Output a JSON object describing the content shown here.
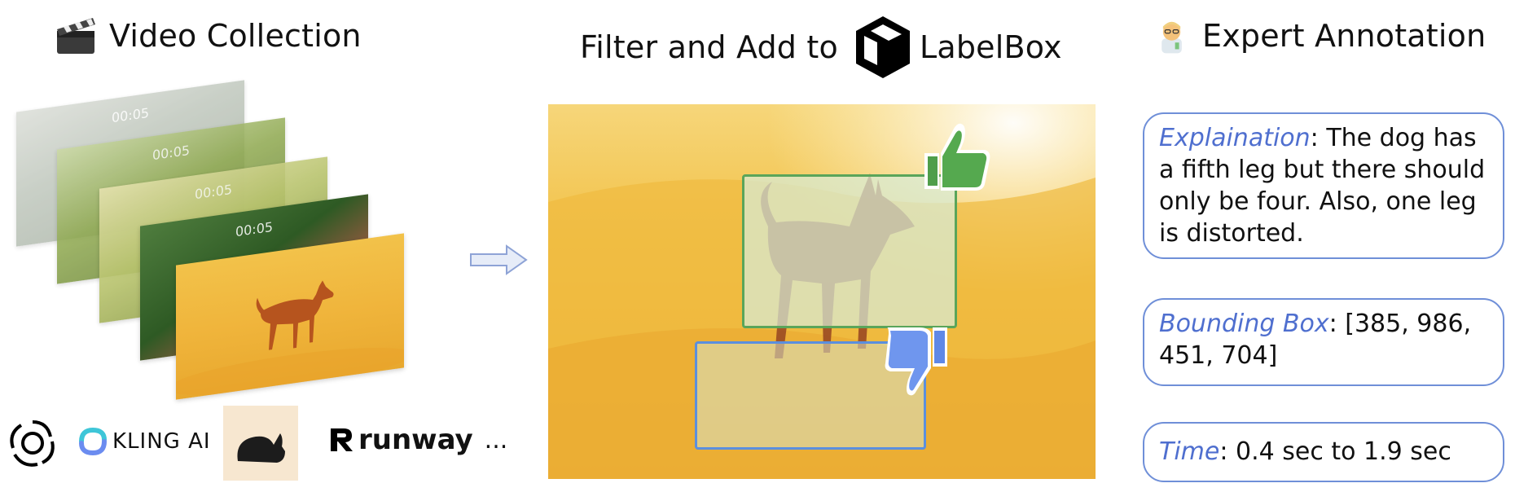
{
  "headings": {
    "video_collection": "Video Collection",
    "filter_prefix": "Filter and Add to",
    "labelbox": "LabelBox",
    "expert": "Expert Annotation"
  },
  "frames": {
    "timestamps": [
      "00:05",
      "00:05",
      "00:05",
      "00:05"
    ]
  },
  "sources": {
    "kling": "KLING AI",
    "runway": "runway",
    "ellipsis": "..."
  },
  "annotations": {
    "explanation_key": "Explaination",
    "explanation_text": ": The dog has a fifth leg but there should only be four. Also, one leg is distorted.",
    "bbox_key": "Bounding Box",
    "bbox_text": ": [385, 986, 451, 704]",
    "time_key": "Time",
    "time_text": ": 0.4 sec to 1.9 sec"
  },
  "icons": {
    "clapper": "clapperboard-icon",
    "scientist": "scientist-emoji-icon",
    "thumbs_up": "thumbs-up-icon",
    "thumbs_down": "thumbs-down-icon"
  },
  "colors": {
    "accent_blue": "#4f6fcf",
    "good_box": "#5aa55a",
    "bad_box": "#5b8fde",
    "sand": "#f2c24a"
  }
}
